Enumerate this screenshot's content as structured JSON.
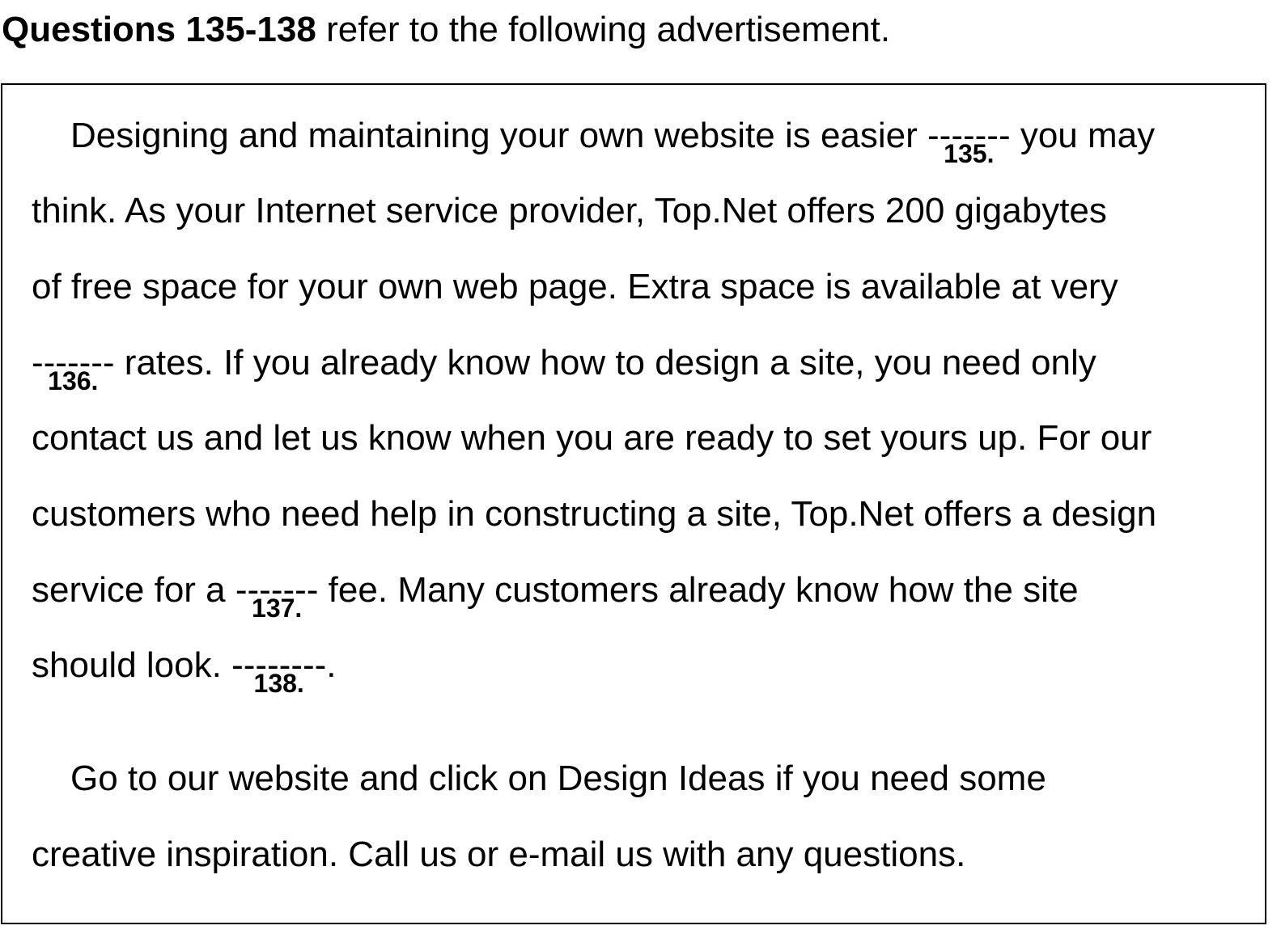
{
  "heading": {
    "bold": "Questions 135-138",
    "rest": " refer to the following advertisement."
  },
  "paragraph1": {
    "line1_a": "Designing and maintaining your own website is easier ",
    "blank135": "-------",
    "num135": "135.",
    "line1_b": " you may",
    "line2": "think.  As your Internet service provider, Top.Net offers 200 gigabytes",
    "line3": "of free space for your own web page.  Extra space is available at very",
    "blank136": "-------",
    "num136": "136.",
    "line4_b": " rates.  If you already know how to design a site, you need only",
    "line5": "contact us and let us know when you are ready to set yours up.  For our",
    "line6": "customers who need help in constructing a site, Top.Net offers a design",
    "line7_a": "service for a ",
    "blank137": "-------",
    "num137": "137.",
    "line7_b": " fee.  Many customers already know how the site",
    "line8_a": "should look.  ",
    "blank138": "--------",
    "num138": "138.",
    "line8_b": "."
  },
  "paragraph2": {
    "line1": "Go to our website and click on Design Ideas if you need some",
    "line2": "creative inspiration.  Call us or e-mail us with any questions."
  }
}
